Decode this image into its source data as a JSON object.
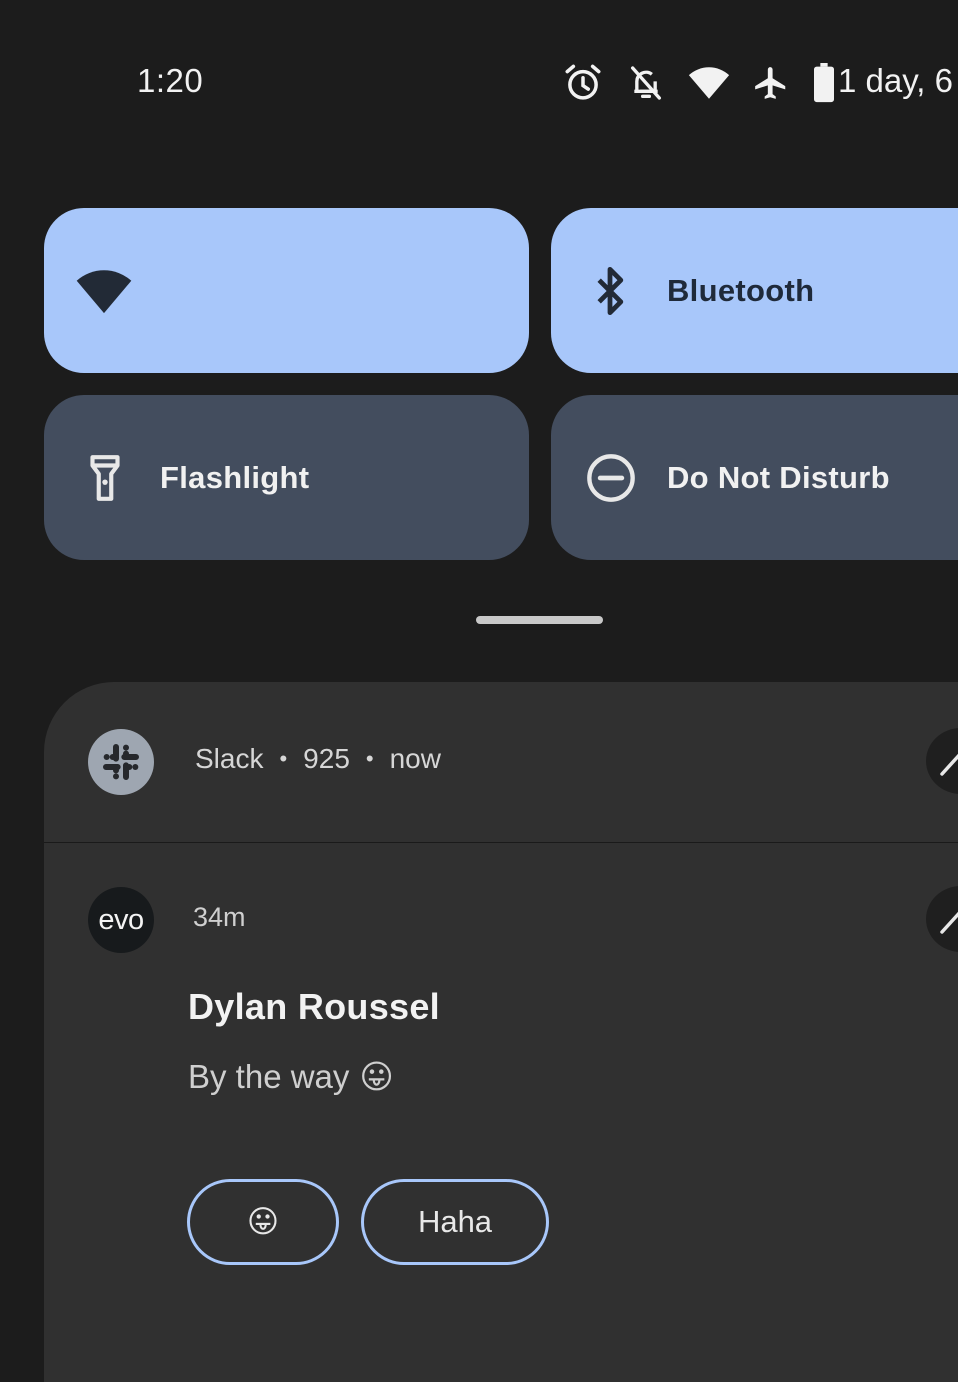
{
  "status_bar": {
    "time": "1:20",
    "battery_text": "1 day, 6",
    "icons": [
      "alarm-icon",
      "notifications-off-icon",
      "wifi-icon",
      "airplane-mode-icon",
      "battery-icon"
    ]
  },
  "quick_settings": {
    "tiles": [
      {
        "name": "wifi",
        "label": "",
        "state": "on",
        "icon": "wifi-icon"
      },
      {
        "name": "bluetooth",
        "label": "Bluetooth",
        "state": "on",
        "icon": "bluetooth-icon"
      },
      {
        "name": "flashlight",
        "label": "Flashlight",
        "state": "off",
        "icon": "flashlight-icon"
      },
      {
        "name": "do-not-disturb",
        "label": "Do Not Disturb",
        "state": "off",
        "icon": "do-not-disturb-icon"
      }
    ]
  },
  "notification": {
    "app": "Slack",
    "count": "925",
    "time": "now",
    "conversation": {
      "avatar_text": "evo",
      "time": "34m",
      "sender": "Dylan Roussel",
      "message": "By the way",
      "message_emoji": "😛"
    },
    "smart_replies": [
      "😛",
      "Haha"
    ]
  },
  "colors": {
    "background": "#1c1c1c",
    "tile_active": "#a8c7fa",
    "tile_inactive": "#434d5e",
    "card": "#303030"
  }
}
